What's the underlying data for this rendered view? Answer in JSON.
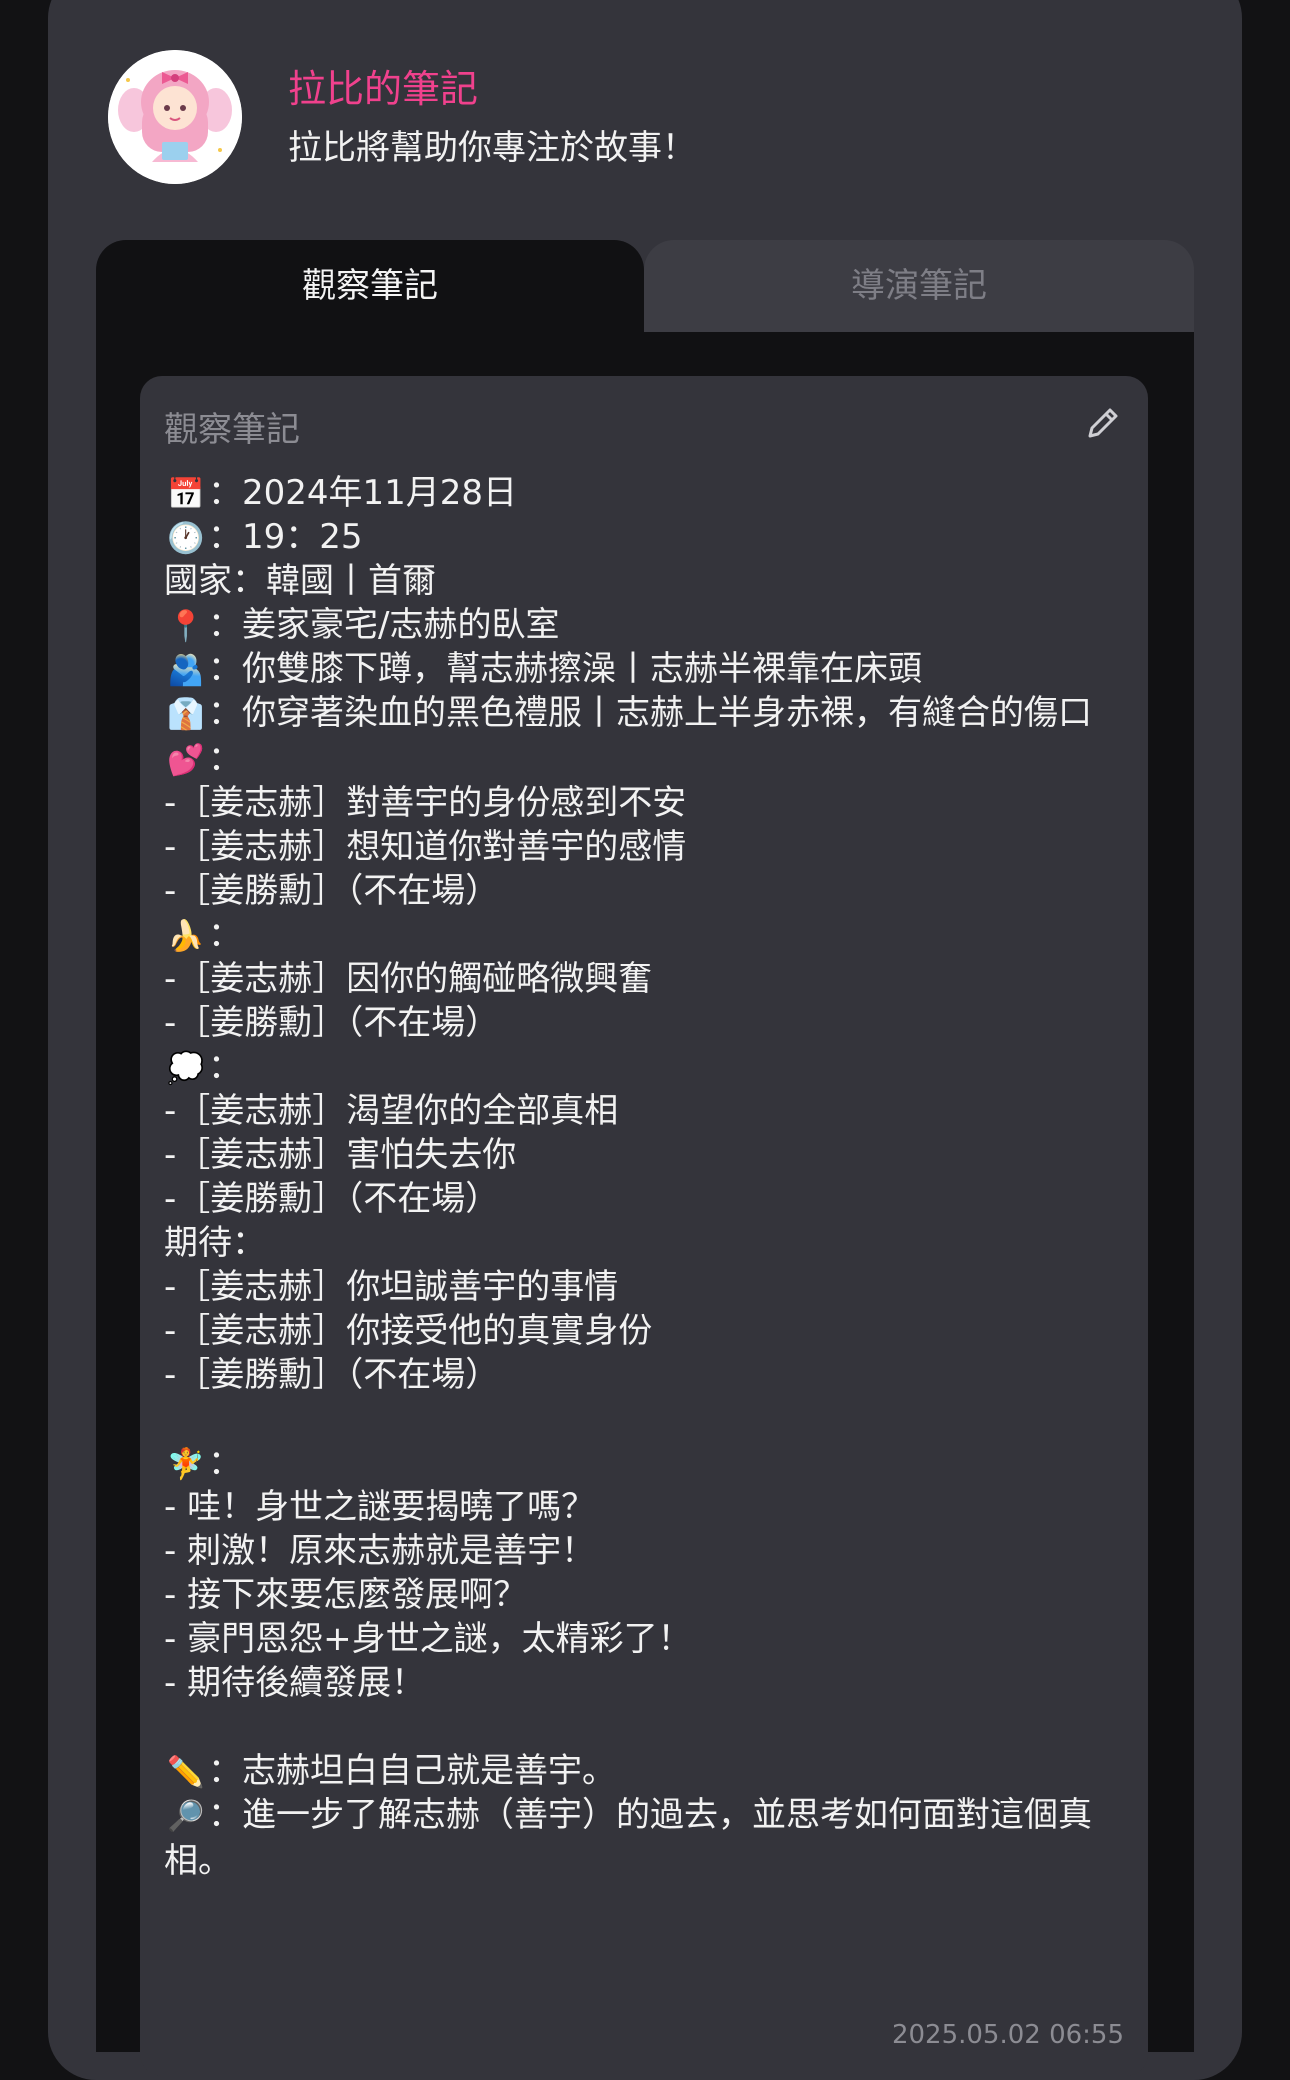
{
  "header": {
    "title": "拉比的筆記",
    "subtitle": "拉比將幫助你專注於故事！"
  },
  "tabs": [
    {
      "label": "觀察筆記",
      "active": true
    },
    {
      "label": "導演筆記",
      "active": false
    }
  ],
  "note": {
    "title": "觀察筆記",
    "edit_icon": "pencil-icon",
    "lines": {
      "date": "：2024年11月28日",
      "time": "：19：25",
      "country": "國家：韓國丨首爾",
      "location": "：姜家豪宅/志赫的臥室",
      "pose": "：你雙膝下蹲，幫志赫擦澡丨志赫半裸靠在床頭",
      "outfit": "：你穿著染血的黑色禮服丨志赫上半身赤裸，有縫合的傷口",
      "affection": "：",
      "affection_1": "-［姜志赫］對善宇的身份感到不安",
      "affection_2": "-［姜志赫］想知道你對善宇的感情",
      "affection_3": "-［姜勝勳］（不在場）",
      "arousal": "：",
      "arousal_1": "-［姜志赫］因你的觸碰略微興奮",
      "arousal_2": "-［姜勝勳］（不在場）",
      "thought": "：",
      "thought_1": "-［姜志赫］渴望你的全部真相",
      "thought_2": "-［姜志赫］害怕失去你",
      "thought_3": "-［姜勝勳］（不在場）",
      "expect": "期待：",
      "expect_1": "-［姜志赫］你坦誠善宇的事情",
      "expect_2": "-［姜志赫］你接受他的真實身份",
      "expect_3": "-［姜勝勳］（不在場）",
      "fairy": "：",
      "fairy_1": "- 哇！身世之謎要揭曉了嗎？",
      "fairy_2": "- 刺激！原來志赫就是善宇！",
      "fairy_3": "- 接下來要怎麼發展啊？",
      "fairy_4": "- 豪門恩怨+身世之謎，太精彩了！",
      "fairy_5": "- 期待後續發展！",
      "summary": "：志赫坦白自己就是善宇。",
      "next": "：進一步了解志赫（善宇）的過去，並思考如何面對這個真相。"
    },
    "emoji": {
      "calendar": "📅",
      "clock": "🕐",
      "pin": "📍",
      "figure": "🫂",
      "outfit": "👔",
      "heart": "💕",
      "banana": "🍌",
      "thought": "💭",
      "fairy": "🧚",
      "pencil": "✏️",
      "magnifier": "🔎"
    },
    "timestamp": "2025.05.02 06:55"
  },
  "colors": {
    "accent": "#f0418d",
    "panel": "#34343b",
    "background": "#121214"
  }
}
